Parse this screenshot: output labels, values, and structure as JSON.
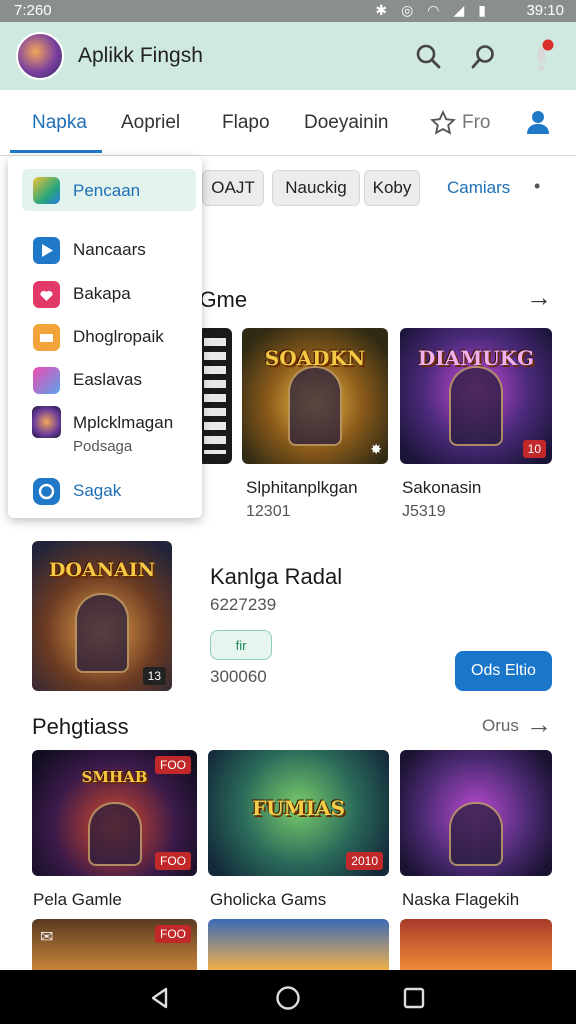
{
  "status_bar": {
    "time_left": "7:260",
    "time_right": "39:10"
  },
  "app_bar": {
    "title": "Aplikk Fingsh"
  },
  "tabs": [
    "Napka",
    "Aopriel",
    "Flapo",
    "Doeyainin",
    "Fro"
  ],
  "chips": [
    "OAJT",
    "Nauckig",
    "Koby"
  ],
  "chip_link": "Camiars",
  "dropdown": {
    "items": [
      {
        "label": "Pencaan",
        "icon": "app-icon",
        "color": "#2aa77a"
      },
      {
        "label": "Nancaars",
        "icon": "play-icon",
        "color": "#1f78c8"
      },
      {
        "label": "Bakapa",
        "icon": "heart-icon",
        "color": "#e23a68"
      },
      {
        "label": "Dhoglropaik",
        "icon": "folder-icon",
        "color": "#f2a33a"
      },
      {
        "label": "Easlavas",
        "icon": "bubble-icon",
        "color": "#5aa5ee"
      },
      {
        "label": "Mplcklmagan",
        "sublabel": "Podsaga",
        "icon": "game-thumb-icon",
        "color": "#6a3c9a"
      },
      {
        "label": "Sagak",
        "icon": "chat-icon",
        "color": "#1f78c8"
      }
    ]
  },
  "section1": {
    "title": "r Gme",
    "cards": [
      {
        "art_title": "",
        "name": "",
        "sub": "",
        "badge": ""
      },
      {
        "art_title": "SOADKN",
        "name": "Slphitanplkgan",
        "sub": "12301",
        "badge": ""
      },
      {
        "art_title": "DIAMUKG",
        "name": "Sakonasin",
        "sub": "J5319",
        "badge": "10"
      }
    ]
  },
  "featured": {
    "art_title": "DOANAIN",
    "title": "Kanlga Radal",
    "sub": "6227239",
    "tag": "fir",
    "count": "300060",
    "install_label": "Ods Eltio",
    "badge": "13"
  },
  "section2": {
    "title": "Pehgtiass",
    "more_label": "Orus",
    "cards": [
      {
        "art_title": "SMHAB",
        "name": "Pela Gamle",
        "badge": "FOO"
      },
      {
        "art_title": "FUMIAS",
        "name": "Gholicka Gams",
        "badge": "2010"
      },
      {
        "art_title": "",
        "name": "Naska Flagekih",
        "badge": ""
      }
    ],
    "row2_badge": "FOO"
  },
  "colors": {
    "accent": "#1f6fb8",
    "appbar_bg": "#cfe8e0",
    "install_bg": "#1976c9",
    "badge_red": "#c0282a"
  }
}
